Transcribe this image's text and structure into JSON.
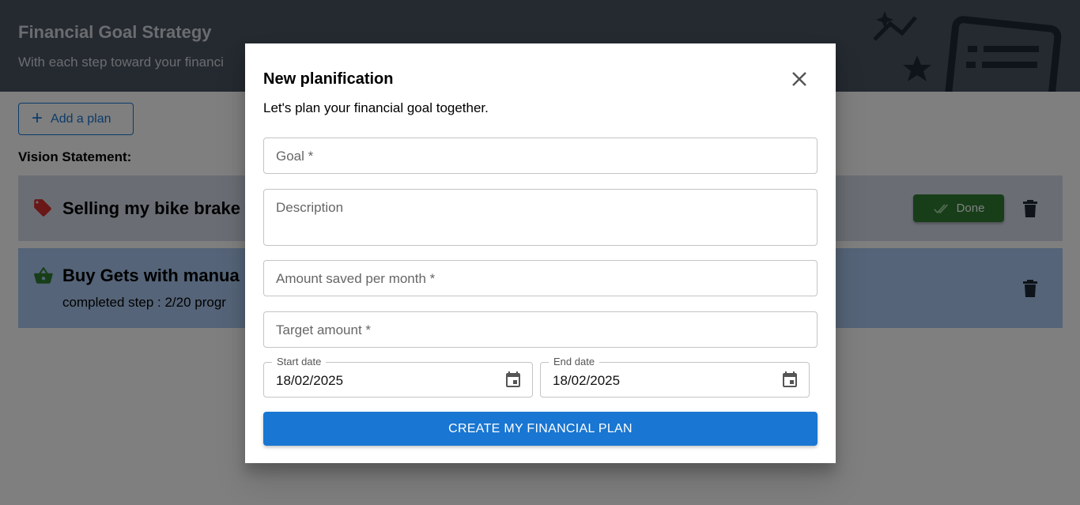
{
  "header": {
    "title": "Financial Goal Strategy",
    "subtitle": "With each step toward your financi"
  },
  "toolbar": {
    "add_plan_label": "Add a plan"
  },
  "vision": {
    "label": "Vision Statement:"
  },
  "plans": [
    {
      "title": "Selling my bike brake",
      "icon": "tag-icon",
      "icon_color": "#d32f2f",
      "done_label": "Done"
    },
    {
      "title": "Buy Gets with manua",
      "icon": "basket-icon",
      "icon_color": "#2e7d32",
      "step_text": "completed step : 2/20  progr"
    }
  ],
  "dialog": {
    "title": "New planification",
    "subtitle": "Let's plan your financial goal together.",
    "fields": {
      "goal": "Goal *",
      "description": "Description",
      "amount": "Amount saved per month *",
      "target": "Target amount *"
    },
    "start_date": {
      "label": "Start date",
      "value": "18/02/2025"
    },
    "end_date": {
      "label": "End date",
      "value": "18/02/2025"
    },
    "submit_label": "CREATE MY FINANCIAL PLAN"
  },
  "colors": {
    "primary": "#1976d2",
    "success": "#2e7d32",
    "header_bg": "#4b5563"
  }
}
